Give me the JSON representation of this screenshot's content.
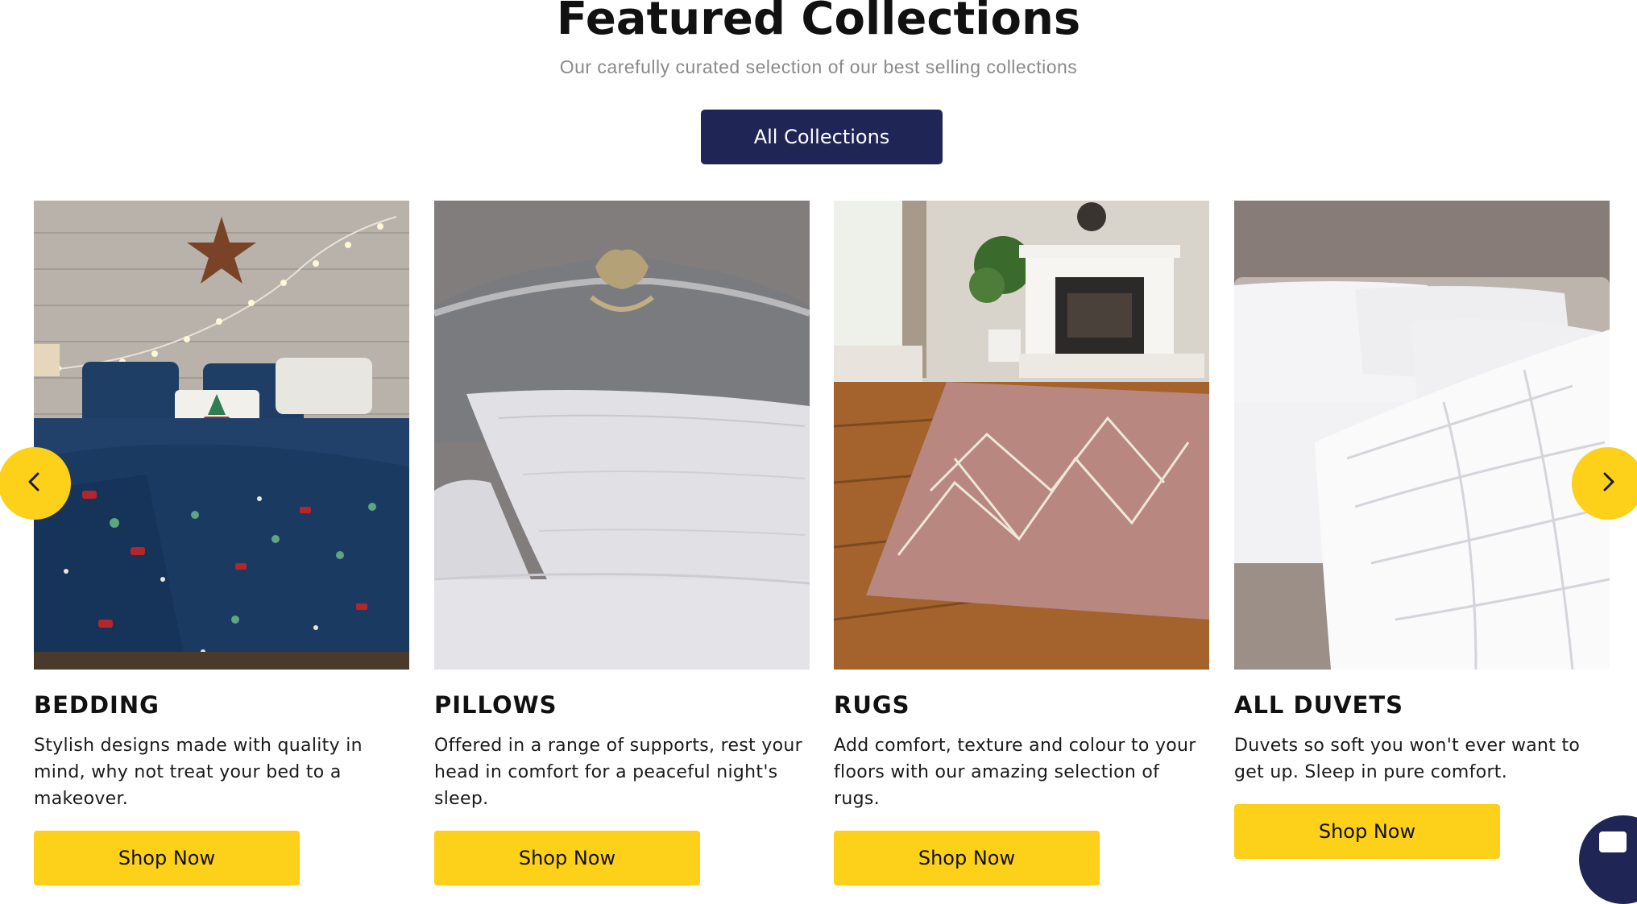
{
  "section": {
    "title": "Featured Collections",
    "subtitle": "Our carefully curated selection of our best selling collections",
    "all_button": "All Collections"
  },
  "collections": [
    {
      "title": "BEDDING",
      "description": "Stylish designs made with quality in mind, why not treat your bed to a makeover.",
      "button": "Shop Now"
    },
    {
      "title": "PILLOWS",
      "description": "Offered in a range of supports, rest your head in comfort for a peaceful night's sleep.",
      "button": "Shop Now"
    },
    {
      "title": "RUGS",
      "description": "Add comfort, texture and colour to your floors with our amazing selection of rugs.",
      "button": "Shop Now"
    },
    {
      "title": "ALL DUVETS",
      "description": "Duvets so soft you won't ever want to get up. Sleep in pure comfort.",
      "button": "Shop Now"
    }
  ],
  "carousel": {
    "prev_icon": "chevron-left-icon",
    "next_icon": "chevron-right-icon"
  },
  "chat": {
    "icon": "chat-icon"
  },
  "colors": {
    "primary": "#1f2554",
    "accent": "#fdd01a",
    "subtitle": "#8a8a8a"
  }
}
